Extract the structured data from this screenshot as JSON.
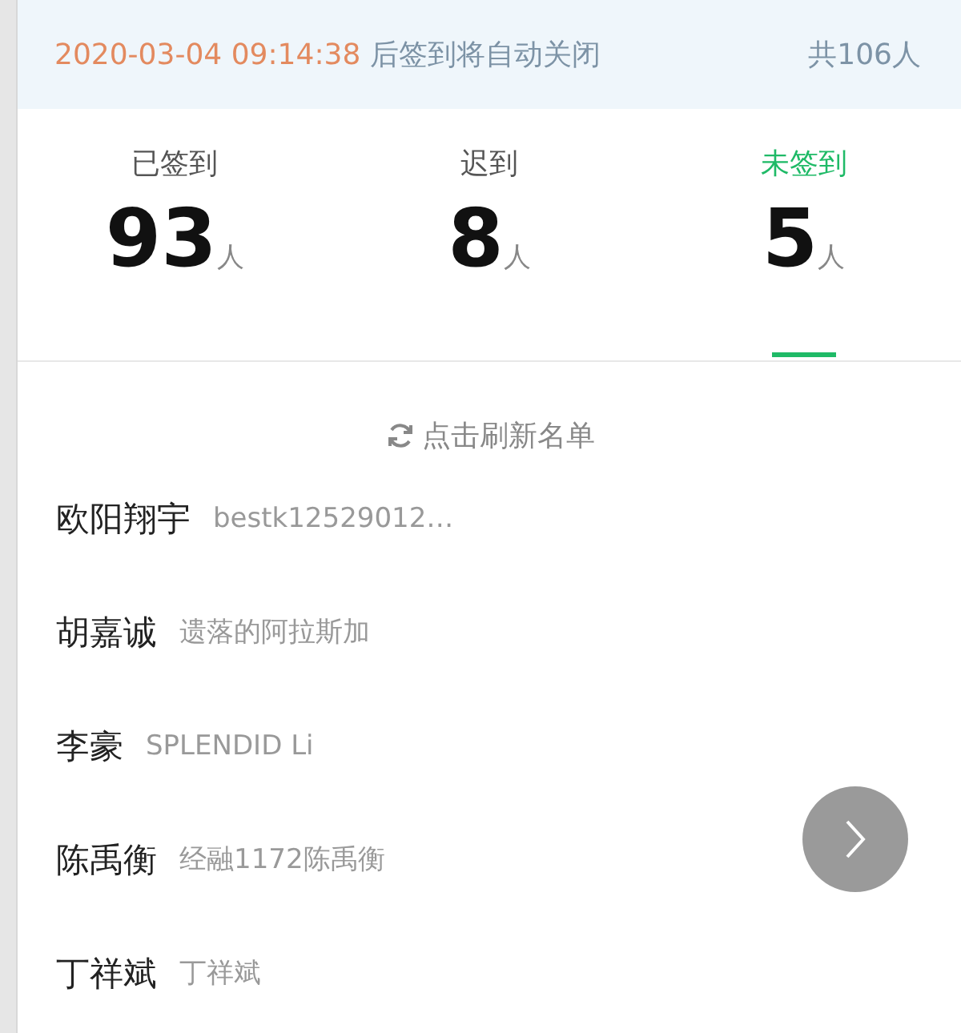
{
  "header": {
    "deadline": "2020-03-04 09:14:38",
    "notice": "后签到将自动关闭",
    "total": "共106人"
  },
  "tabs": [
    {
      "label": "已签到",
      "count": "93",
      "unit": "人",
      "selected": false
    },
    {
      "label": "迟到",
      "count": "8",
      "unit": "人",
      "selected": false
    },
    {
      "label": "未签到",
      "count": "5",
      "unit": "人",
      "selected": true
    }
  ],
  "refresh": {
    "label": "点击刷新名单"
  },
  "people": [
    {
      "name": "欧阳翔宇",
      "nickname": "bestk12529012…"
    },
    {
      "name": "胡嘉诚",
      "nickname": "遗落的阿拉斯加"
    },
    {
      "name": "李豪",
      "nickname": "SPLENDID Li"
    },
    {
      "name": "陈禹衡",
      "nickname": "经融1172陈禹衡"
    },
    {
      "name": "丁祥斌",
      "nickname": "丁祥斌"
    }
  ],
  "floating_button": {
    "kind": "next"
  }
}
